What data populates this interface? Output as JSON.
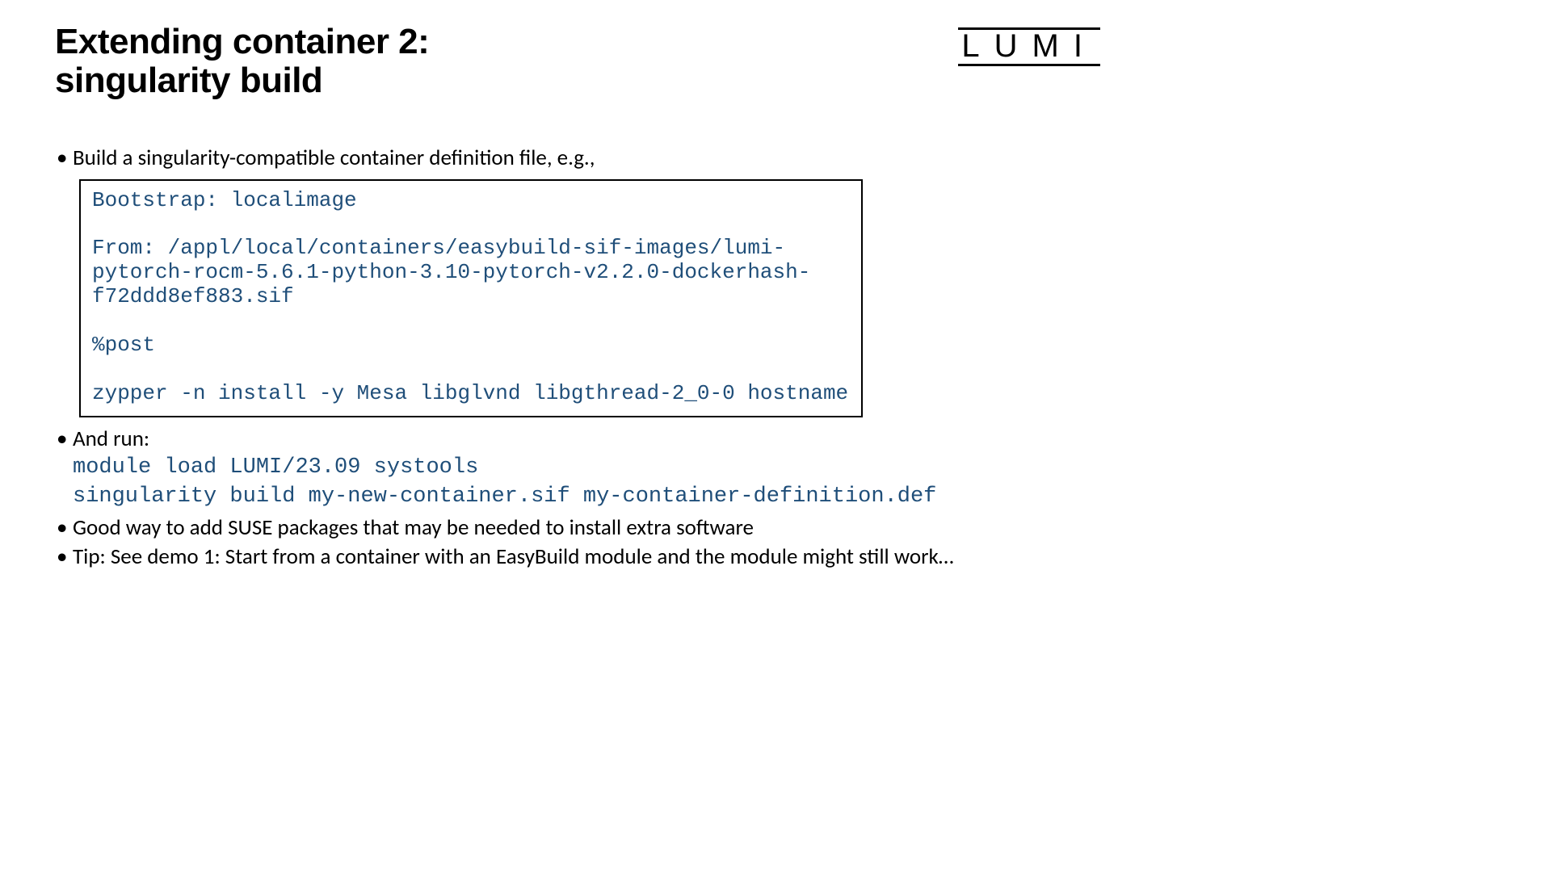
{
  "title_line1": "Extending container 2:",
  "title_line2": "singularity build",
  "logo": "LUMI",
  "bullet1": "Build a singularity-compatible container definition file, e.g.,",
  "codebox_line1": "Bootstrap: localimage",
  "codebox_blank1": " ",
  "codebox_line2": "From: /appl/local/containers/easybuild-sif-images/lumi-pytorch-rocm-5.6.1-python-3.10-pytorch-v2.2.0-dockerhash-f72ddd8ef883.sif",
  "codebox_blank2": " ",
  "codebox_line3": "%post",
  "codebox_blank3": " ",
  "codebox_line4": "zypper -n install -y Mesa libglvnd libgthread-2_0-0 hostname",
  "bullet2_text": "And run:",
  "bullet2_code1": "module load LUMI/23.09 systools",
  "bullet2_code2": "singularity build my-new-container.sif my-container-definition.def",
  "bullet3": "Good way to add SUSE packages that may be needed to install extra software",
  "bullet4": "Tip: See demo 1: Start from a container with an EasyBuild module and the module might still work…",
  "dot": "•"
}
